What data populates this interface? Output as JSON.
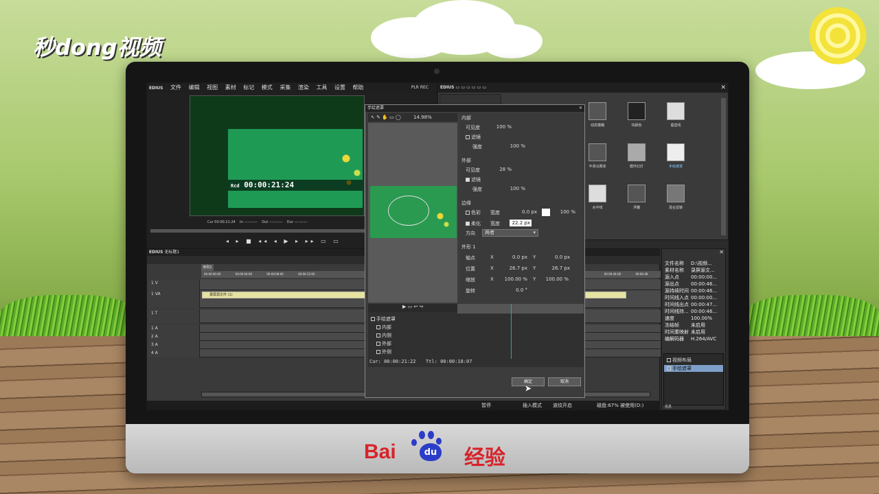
{
  "watermark": {
    "logo": "秒dong视频"
  },
  "branding": {
    "baidu_prefix": "Bai",
    "baidu_paw": "du",
    "baidu_suffix": "经验"
  },
  "edius": {
    "app_name": "EDIUS",
    "menu": [
      "文件",
      "编辑",
      "视图",
      "素材",
      "标记",
      "模式",
      "采集",
      "渲染",
      "工具",
      "设置",
      "帮助"
    ],
    "rec_label": "PLR REC",
    "preview": {
      "rcd_label": "Rcd",
      "timecode": "00:00:21:24"
    },
    "timeline_info": {
      "cur": "Cur 00:00:21:24",
      "in": "In --:--:--:--",
      "out": "Out --:--:--:--",
      "dur": "Dur --:--:--:--"
    },
    "project_title": "无标题1",
    "sequence_tab": "序列1",
    "ruler_marks": [
      "00:00:00:00",
      "00:00:04:00",
      "00:00:08:00",
      "00:00:12:00",
      "00:00:44:00",
      "00:00:48"
    ],
    "tracks": [
      "1 V",
      "1 VA",
      "1 T",
      "1 A",
      "2 A",
      "3 A",
      "4 A"
    ],
    "clip_label": "录屏源文件 (1)",
    "status": {
      "pause": "暂停",
      "insert_mode": "插入模式",
      "ripple": "波纹开启",
      "disk": "磁盘:67% 被使用(D:)"
    }
  },
  "effects": {
    "items": [
      "动态模糊",
      "块颜色",
      "垂直线",
      "平滑马赛克",
      "循环幻灯",
      "手绘遮罩",
      "水平线",
      "浮雕",
      "混合滤镜"
    ]
  },
  "properties": {
    "rows": [
      [
        "文件名称",
        "D:\\视频..."
      ],
      [
        "素材名称",
        "录屏源文..."
      ],
      [
        "源入点",
        "00:00:00..."
      ],
      [
        "源出点",
        "00:00:46..."
      ],
      [
        "源持续时间",
        "00:00:46..."
      ],
      [
        "时间线入点",
        "00:00:00..."
      ],
      [
        "时间线出点",
        "00:00:47..."
      ],
      [
        "时间线持...",
        "00:00:46..."
      ],
      [
        "速度",
        "100.00%"
      ],
      [
        "冻结帧",
        "未启用"
      ],
      [
        "时间重映射",
        "未启用"
      ],
      [
        "编解码器",
        "H.264/AVC"
      ]
    ],
    "info_items": [
      "视频布局",
      "手绘遮罩"
    ],
    "info_tab": "信息"
  },
  "dialog": {
    "title": "手绘遮罩",
    "zoom": "14.98%",
    "inner": {
      "header": "内部",
      "visibility_label": "可见度",
      "visibility": "100 %",
      "filter_label": "滤镜",
      "strength_label": "强度",
      "strength": "100 %"
    },
    "outer": {
      "header": "外部",
      "visibility_label": "可见度",
      "visibility": "28 %",
      "filter_label": "滤镜",
      "strength_label": "强度",
      "strength": "100 %"
    },
    "edge": {
      "header": "边缘",
      "color_label": "色彩",
      "width_label": "宽度",
      "width": "0.0 px",
      "opacity": "100 %",
      "soft_label": "柔化",
      "soft_width_label": "宽度",
      "soft_width": "22.2 px",
      "direction_label": "方向",
      "direction": "两者"
    },
    "shape": {
      "header": "外形 1",
      "axis_label": "轴点",
      "axis_x": "0.0 px",
      "axis_y": "0.0 px",
      "pos_label": "位置",
      "pos_x": "26.7 px",
      "pos_y": "26.7 px",
      "scale_label": "缩放",
      "scale_x": "100.00 %",
      "scale_y": "100.00 %",
      "rot_label": "旋转",
      "rot": "0.0 °",
      "x": "X",
      "y": "Y"
    },
    "layers": [
      "手绘遮罩",
      "内部",
      "内侧",
      "外部",
      "外侧"
    ],
    "cur": "Cur: 00:00:21:22",
    "ttl": "Ttl: 00:00:18:07",
    "ok": "确定",
    "cancel": "取消"
  }
}
